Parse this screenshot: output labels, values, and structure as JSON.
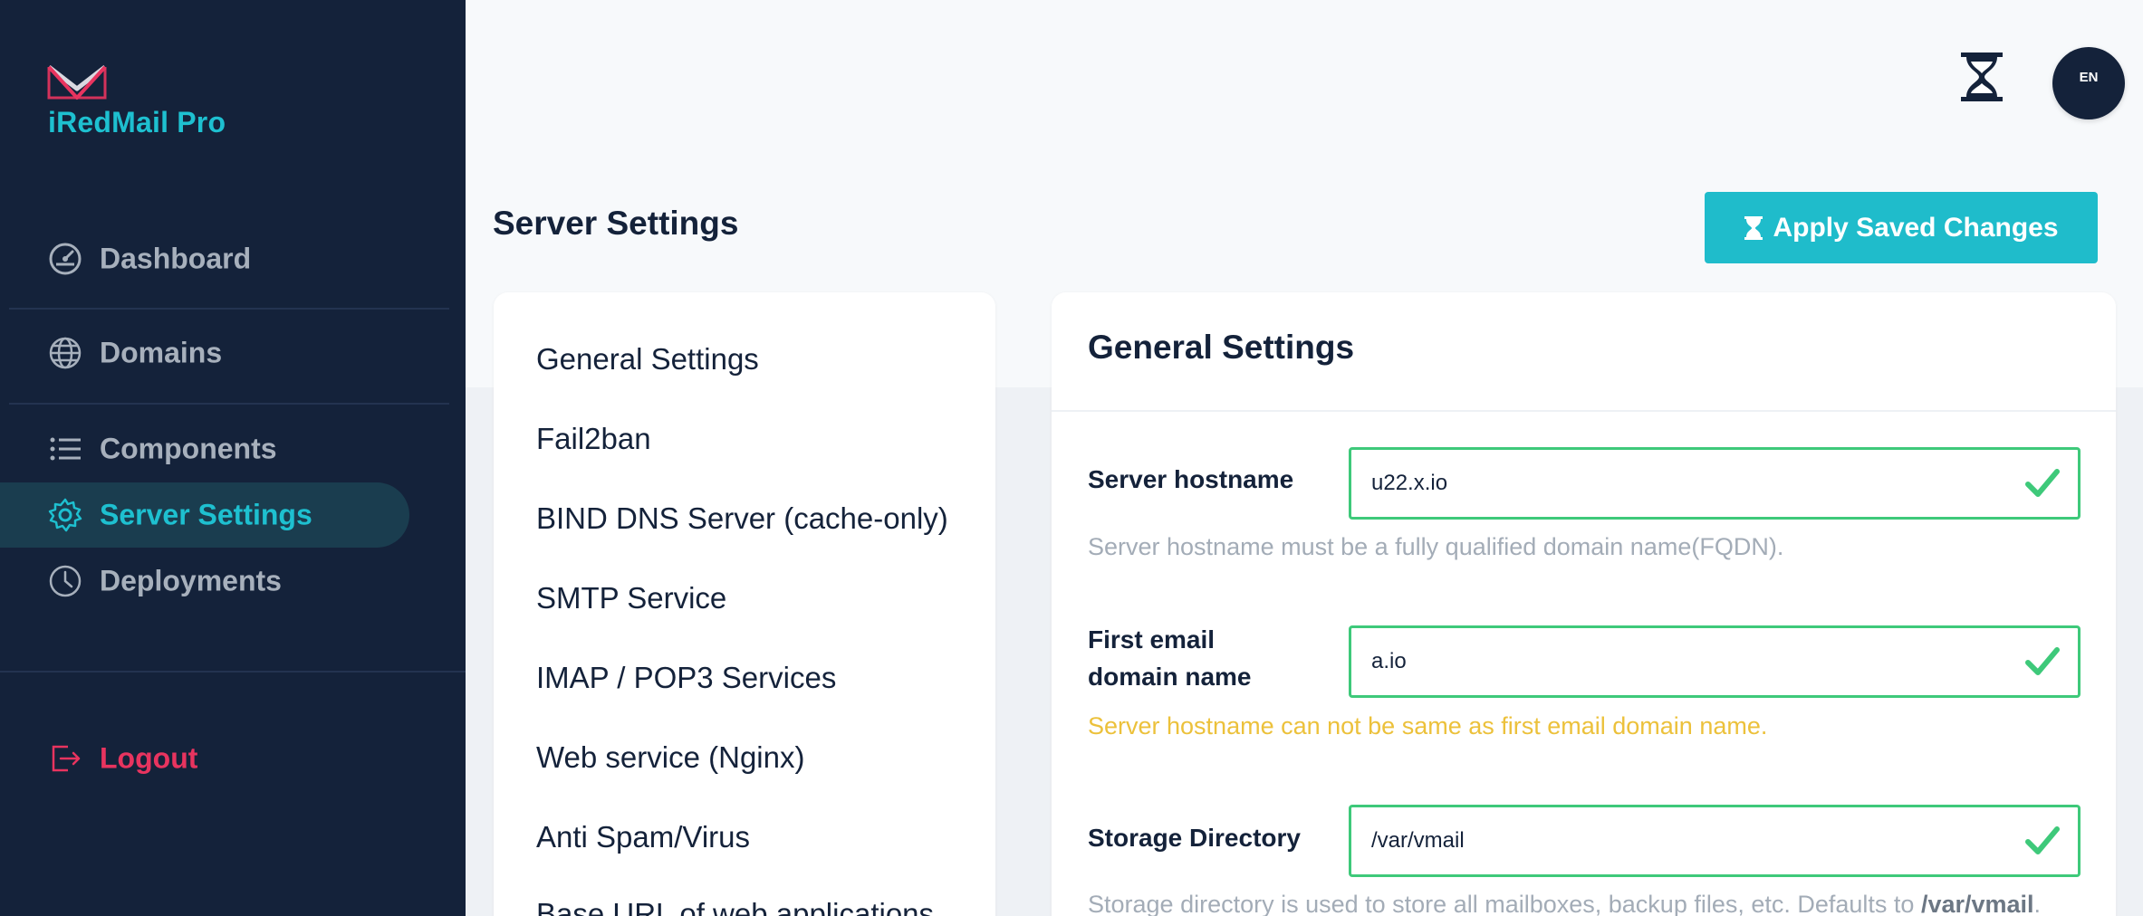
{
  "app": {
    "name": "iRedMail Pro"
  },
  "sidebar": {
    "items": [
      {
        "label": "Dashboard",
        "icon": "dashboard-gauge-icon"
      },
      {
        "label": "Domains",
        "icon": "globe-icon"
      },
      {
        "label": "Components",
        "icon": "list-icon"
      },
      {
        "label": "Server Settings",
        "icon": "gear-icon",
        "active": true
      },
      {
        "label": "Deployments",
        "icon": "clock-icon"
      }
    ],
    "logout": {
      "label": "Logout",
      "icon": "logout-icon"
    }
  },
  "topbar": {
    "language": "EN",
    "pending_icon": "hourglass-icon"
  },
  "page": {
    "title": "Server Settings",
    "apply_button": "Apply Saved Changes"
  },
  "settings_menu": {
    "items": [
      "General Settings",
      "Fail2ban",
      "BIND DNS Server (cache-only)",
      "SMTP Service",
      "IMAP / POP3 Services",
      "Web service (Nginx)",
      "Anti Spam/Virus",
      "Base URL of web applications"
    ]
  },
  "general": {
    "title": "General Settings",
    "hostname": {
      "label": "Server hostname",
      "value": "u22.x.io",
      "hint": "Server hostname must be a fully qualified domain name(FQDN)."
    },
    "first_domain": {
      "label_line1": "First email",
      "label_line2": "domain name",
      "value": "a.io",
      "warning": "Server hostname can not be same as first email domain name."
    },
    "storage": {
      "label": "Storage Directory",
      "value": "/var/vmail",
      "hint_prefix": "Storage directory is used to store all mailboxes, backup files, etc. Defaults to ",
      "hint_bold": "/var/vmail",
      "hint_suffix": "."
    }
  },
  "colors": {
    "sidebar_bg": "#14223a",
    "accent": "#1ec0d0",
    "logout": "#e8345f",
    "valid": "#3ec97a",
    "warning": "#ecc13b"
  }
}
